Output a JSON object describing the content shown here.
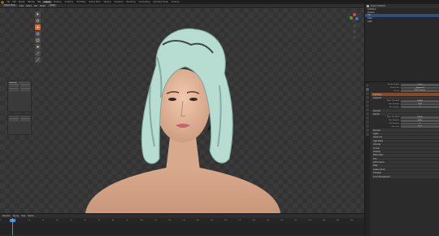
{
  "topbar": {
    "menus": [
      "File",
      "Edit",
      "Render",
      "Window",
      "Help"
    ],
    "workspaces": [
      "Layout",
      "Modeling",
      "Sculpting",
      "UV Editing",
      "Texture Paint",
      "Shading",
      "Animation",
      "Rendering",
      "Compositing",
      "Geometry Nodes",
      "Scripting"
    ],
    "active_workspace": "Layout"
  },
  "viewport_header": {
    "mode": "Object Mode",
    "items": [
      "View",
      "Select",
      "Add",
      "Object"
    ],
    "orientation": "Global"
  },
  "outliner": {
    "title": "Scene Collection",
    "items": [
      "Collection",
      "Camera",
      "Hair",
      "Head",
      "Light"
    ]
  },
  "properties": {
    "sections": [
      "Render Engine",
      "Feature Set",
      "Device",
      "Sampling",
      "Viewport",
      "Noise Threshold",
      "Max Samples",
      "Min Samples",
      "Denoise",
      "Render",
      "Noise Threshold",
      "Max Samples",
      "Min Samples",
      "Time Limit",
      "Denoise",
      "Lights",
      "Advanced",
      "Light Paths",
      "Volumes",
      "Curves",
      "Simplify",
      "Motion Blur",
      "Film",
      "Performance",
      "Bake",
      "Grease Pencil",
      "Freestyle",
      "Color Management"
    ],
    "values": [
      "Cycles",
      "Supported",
      "GPU Compute",
      "0.1000",
      "1024",
      "0",
      "0.0100",
      "4096",
      "0",
      "0 sec"
    ]
  },
  "timeline": {
    "menus": [
      "Playback",
      "Keying",
      "View",
      "Marker"
    ],
    "current_frame": "1",
    "ruler": [
      "0",
      "10",
      "20",
      "30",
      "40",
      "50",
      "60",
      "70",
      "80",
      "90",
      "100",
      "110",
      "120",
      "130",
      "140",
      "150",
      "160",
      "170",
      "180",
      "190",
      "200",
      "210",
      "220",
      "230",
      "240",
      "250"
    ]
  },
  "colors": {
    "accent": "#e0672d",
    "selection": "#334d80",
    "playhead": "#4a90e0",
    "hair": "#b7ddd3",
    "skin": "#e1b396"
  }
}
